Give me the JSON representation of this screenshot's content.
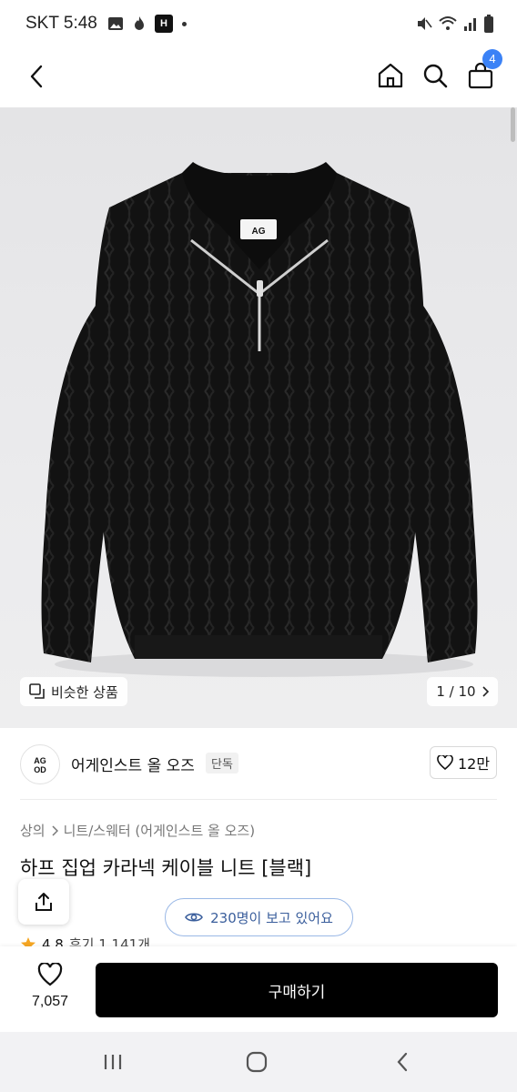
{
  "status_bar": {
    "time": "SKT 5:48",
    "notification_badge": "H",
    "battery": "battery-icon"
  },
  "header": {
    "cart_count": "4"
  },
  "gallery": {
    "similar_label": "비슷한 상품",
    "page_indicator": "1 / 10",
    "product_label_text": "AG"
  },
  "brand": {
    "logo_line1": "AG",
    "logo_line2": "OD",
    "name": "어게인스트 올 오즈",
    "tag": "단독",
    "likes": "12만"
  },
  "product": {
    "breadcrumb": [
      "상의",
      "니트/스웨터 (어게인스트 올 오즈)"
    ],
    "title": "하프 집업 카라넥 케이블 니트 [블랙]",
    "viewers": "230명이 보고 있어요",
    "rating": "4.8",
    "reviews": "후기 1,141개"
  },
  "actions": {
    "wish_count": "7,057",
    "buy_label": "구매하기"
  },
  "colors": {
    "accent": "#3b82f6",
    "buy_button": "#000000",
    "star": "#f5a623"
  }
}
